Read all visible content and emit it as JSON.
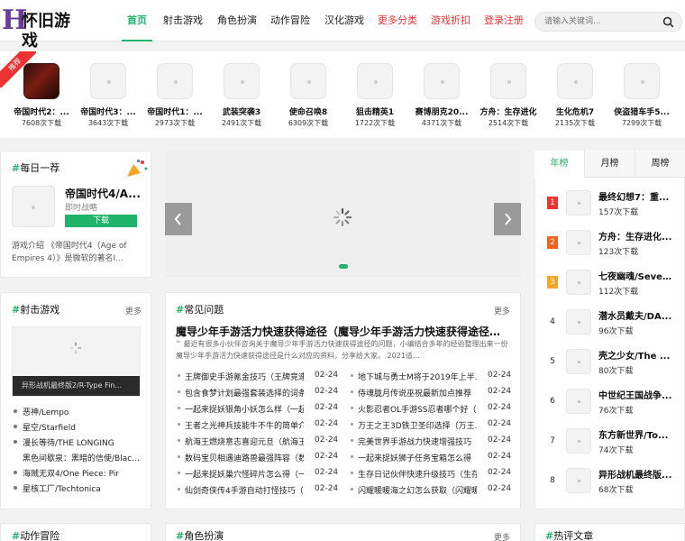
{
  "header": {
    "logo_letter": "H",
    "logo_text": "怀旧游戏",
    "nav": [
      {
        "label": "首页"
      },
      {
        "label": "射击游戏"
      },
      {
        "label": "角色扮演"
      },
      {
        "label": "动作冒险"
      },
      {
        "label": "汉化游戏"
      },
      {
        "label": "更多分类"
      },
      {
        "label": "游戏折扣"
      },
      {
        "label": "登录注册"
      }
    ],
    "search_placeholder": "请输入关键词...",
    "accent_color": "#20b36a"
  },
  "recommend": {
    "badge": "推荐",
    "items": [
      {
        "name": "帝国时代2：...",
        "count": "7608次下载"
      },
      {
        "name": "帝国时代3：...",
        "count": "3643次下载"
      },
      {
        "name": "帝国时代1：...",
        "count": "2973次下载"
      },
      {
        "name": "武装突袭3",
        "count": "2491次下载"
      },
      {
        "name": "使命召唤8",
        "count": "6309次下载"
      },
      {
        "name": "狙击精英1",
        "count": "1722次下载"
      },
      {
        "name": "赛博朋克20...",
        "count": "4371次下载"
      },
      {
        "name": "方舟：生存进化",
        "count": "2514次下载"
      },
      {
        "name": "生化危机7",
        "count": "2135次下载"
      },
      {
        "name": "侠盗猎车手5...",
        "count": "7299次下载"
      }
    ]
  },
  "daily": {
    "title": "每日一荐",
    "game": "帝国时代4/A...",
    "genre": "即时战略",
    "button": "下载",
    "intro": "游戏介绍 《帝国时代4（Age of Empires 4）》是微软的著名I..."
  },
  "shooter": {
    "title": "射击游戏",
    "more": "更多",
    "banner_caption": "异形战机最终版2/R-Type Fin...",
    "items": [
      "恶神/Lempo",
      "星空/Starfield",
      "漫长等待/THE LONGING",
      "黑色间歇泉：黑暗的信使/Black ...",
      "海贼无双4/One Piece: Pir",
      "星核工厂/Techtonica"
    ]
  },
  "faq": {
    "title": "常见问题",
    "more": "更多",
    "headline": "魔导少年手游活力快速获得途径（魔导少年手游活力快速获得途径是...",
    "summary": "最近有很多小伙伴咨询关于魔导少年手游活力快速获得途径的问题，小编结合多年的经验整理出来一份魔导少年手游活力快速获得途径是什么对应的资料，分享给大家。 2021适...",
    "left": [
      {
        "title": "王牌御史手游氪金技巧（王牌竞速...",
        "date": "02-24"
      },
      {
        "title": "包含食梦计划最强套装选择的词条",
        "date": "02-24"
      },
      {
        "title": "一起来捉妖银角小妖怎么样（一起...",
        "date": "02-24"
      },
      {
        "title": "王者之光神兵技能牛不牛的简单介...",
        "date": "02-24"
      },
      {
        "title": "航海王燃烧意志喜迎元旦（航海王...",
        "date": "02-24"
      },
      {
        "title": "数码宝贝相遇迪路兽最强阵容（数...",
        "date": "02-24"
      },
      {
        "title": "一起来捉妖巢穴怪碎片怎么得（一...",
        "date": "02-24"
      },
      {
        "title": "仙剑奇侠传4手游自动打怪技巧（...",
        "date": "02-24"
      }
    ],
    "right": [
      {
        "title": "地下城与勇士M将于2019年上半...",
        "date": "02-24"
      },
      {
        "title": "侍魂胧月传说巫祝最新加点推荐（...",
        "date": "02-24"
      },
      {
        "title": "火影忍者OL手游SS忍者哪个好（...",
        "date": "02-24"
      },
      {
        "title": "万王之王3D铁卫圣印选择（万王...",
        "date": "02-24"
      },
      {
        "title": "完美世界手游战力快速增强技巧（...",
        "date": "02-24"
      },
      {
        "title": "一起来捉妖狮子任务宝箱怎么得（...",
        "date": "02-24"
      },
      {
        "title": "生存日记伙伴快速升级技巧（生存...",
        "date": "02-24"
      },
      {
        "title": "闪耀暖暖海之幻怎么获取（闪耀暖...",
        "date": "02-24"
      }
    ]
  },
  "ranking": {
    "tabs": [
      "年榜",
      "月榜",
      "周榜"
    ],
    "items": [
      {
        "rank": "1",
        "name": "最终幻想7：重...",
        "count": "157次下载"
      },
      {
        "rank": "2",
        "name": "方舟：生存进化...",
        "count": "123次下载"
      },
      {
        "rank": "3",
        "name": "七夜幽魂/Seve...",
        "count": "112次下载"
      },
      {
        "rank": "4",
        "name": "潜水员戴夫/DA...",
        "count": "96次下载"
      },
      {
        "rank": "5",
        "name": "壳之少女/The ...",
        "count": "80次下载"
      },
      {
        "rank": "6",
        "name": "中世纪王国战争...",
        "count": "76次下载"
      },
      {
        "rank": "7",
        "name": "东方新世界/To...",
        "count": "74次下载"
      },
      {
        "rank": "8",
        "name": "异形战机最终版...",
        "count": "68次下载"
      }
    ]
  },
  "bottom": {
    "action": "动作冒险",
    "rpg": "角色扮演",
    "rpg_more": "更多",
    "hot": "热评文章"
  }
}
